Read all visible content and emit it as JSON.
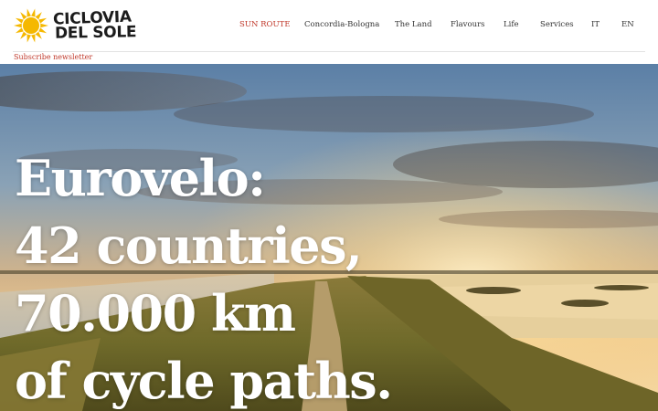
{
  "brand": {
    "line1": "CICLOVIA",
    "line2": "DEL SOLE",
    "accent": "#f5b800"
  },
  "nav": {
    "items": [
      {
        "label": "SUN ROUTE",
        "active": true
      },
      {
        "label": "Concordia-Bologna",
        "active": false
      },
      {
        "label": "The Land",
        "active": false
      },
      {
        "label": "Flavours",
        "active": false
      },
      {
        "label": "Life",
        "active": false
      },
      {
        "label": "Services",
        "active": false
      },
      {
        "label": "IT",
        "active": false
      },
      {
        "label": "EN",
        "active": false
      }
    ]
  },
  "subscribe": {
    "label": "Subscribe newsletter"
  },
  "hero": {
    "lines": [
      "Eurovelo:",
      "42 countries,",
      "70.000 km",
      "of cycle paths."
    ]
  },
  "colors": {
    "accent_red": "#c0392b",
    "sun_yellow": "#f5b800"
  }
}
